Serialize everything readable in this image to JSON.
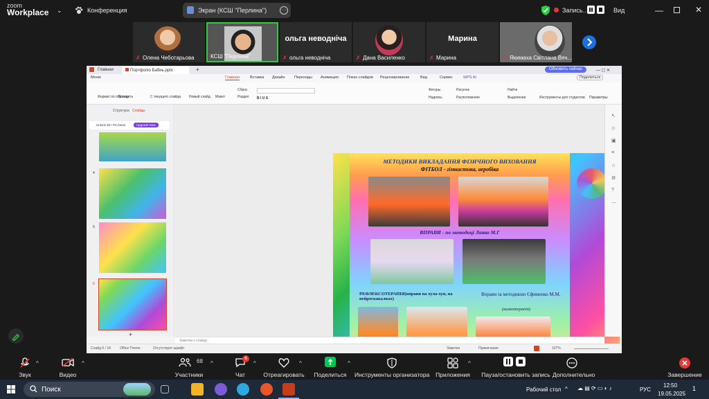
{
  "zoom": {
    "logo_line1": "zoom",
    "logo_line2": "Workplace",
    "meeting_label": "Конференция",
    "share_title": "Экран (КСШ \"Перлина\")",
    "record_label": "Запись…",
    "view_label": "Вид"
  },
  "participants": [
    {
      "name": "Олена Чеботарьова"
    },
    {
      "name": "КСШ \"Перлина\""
    },
    {
      "name": "ольга неводніча",
      "center_name": "ольга неводніча"
    },
    {
      "name": "Дана Василенко"
    },
    {
      "name": "Марина",
      "center_name": "Марина"
    },
    {
      "name": "Якимаха Світлана Вяч..."
    }
  ],
  "wps": {
    "tab_home": "Главная",
    "tab_file": "Портфоліо Бабиь.pptx",
    "update_btn": "Обновить сейчас",
    "menu": [
      "Меню",
      "Главная",
      "Вставка",
      "Дизайн",
      "Переходы",
      "Анимация",
      "Показ слайдов",
      "Рецензирование",
      "Вид",
      "Сервис",
      "WPS AI"
    ],
    "share_btn": "Поделиться",
    "ribbon": {
      "format": "Формат по образцу",
      "paste": "Вставить",
      "from_slide": "С текущего слайда",
      "new_slide": "Новый слайд",
      "layout": "Макет",
      "reset": "Сброс",
      "section": "Раздел",
      "shapes": "Фигуры",
      "picture": "Рисунок",
      "caption": "Надпись",
      "arrange": "Расположение",
      "find": "Найти",
      "select": "Выделение",
      "tools": "Инструменты для студентов",
      "params": "Параметры"
    },
    "panel_tabs": [
      "Структура",
      "Слайды"
    ],
    "promo_text": "Unlock 30+ Pro bene",
    "promo_btn": "Upgrade Now",
    "slide_numbers": [
      "4",
      "5",
      "6"
    ],
    "notes_placeholder": "Заметки к слайду",
    "status": {
      "slide_count": "Слайд 6 / 18",
      "theme": "Office Theme",
      "font_missing": "Отсутствует шрифт",
      "notes": "Заметки",
      "comment": "Примечание",
      "zoom": "107%"
    }
  },
  "slide": {
    "title": "МЕТОДИКИ  ВИКЛАДАННЯ ФІЗИЧНОГО ВИХОВАННЯ",
    "subtitle": "ФІТБОЛ - гімнастика, аеробіка",
    "exercises": "ВПРАВИ  - по методиці  Лаяко М.Г",
    "reflex": "РЕФЛЕКСОТЕРАПІЯ(вправи  на  хула-хуп, на  нейроскакалках)",
    "method2": "Вправи  за  методикою Єфименко М.М.",
    "method2_sub": "(казкотерапія)"
  },
  "controls": [
    {
      "label": "Звук"
    },
    {
      "label": "Видео"
    },
    {
      "label": "Участники",
      "count": "68"
    },
    {
      "label": "Чат",
      "badge": "6"
    },
    {
      "label": "Отреагировать"
    },
    {
      "label": "Поделиться"
    },
    {
      "label": "Инструменты организатора"
    },
    {
      "label": "Приложения"
    },
    {
      "label": "Пауза/остановить запись"
    },
    {
      "label": "Дополнительно"
    },
    {
      "label": "Завершение"
    }
  ],
  "taskbar": {
    "search": "Поиск",
    "desktop": "Рабочий стол",
    "lang": "РУС",
    "time": "12:50",
    "date": "19.05.2025",
    "notif": "1"
  },
  "colors": {
    "zoom_bg": "#1a1a1a",
    "share_green": "#00c853",
    "end_red": "#e53935",
    "wps_accent": "#d14424",
    "taskbar": "#1f2a38"
  }
}
